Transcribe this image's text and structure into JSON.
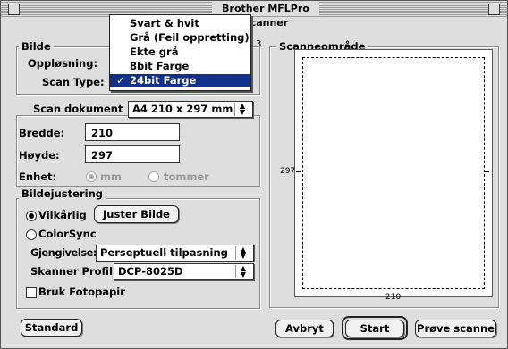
{
  "window": {
    "title": "Brother MFLPro Scanner"
  },
  "image_group": {
    "label": "Bilde",
    "resolution_label": "Oppløsning:",
    "scan_type_label": "Scan Type:",
    "hidden_digit": "3"
  },
  "scan_type_menu": {
    "items": [
      "Svart & hvit",
      "Grå (Feil oppretting)",
      "Ekte grå",
      "8bit Farge",
      "24bit Farge"
    ],
    "selected": "24bit Farge",
    "check_glyph": "✓"
  },
  "document_group": {
    "label": "Scan dokument",
    "size_value": "A4 210 x 297 mm",
    "width_label": "Bredde:",
    "width_value": "210",
    "height_label": "Høyde:",
    "height_value": "297",
    "unit_label": "Enhet:",
    "unit_mm": "mm",
    "unit_inch": "tommer"
  },
  "adjust_group": {
    "label": "Bildejustering",
    "arbitrary_label": "Vilkårlig",
    "adjust_button": "Juster Bilde",
    "colorsync_label": "ColorSync",
    "rendering_label": "Gjengivelse:",
    "rendering_value": "Perseptuell tilpasning",
    "profile_label": "Skanner Profil:",
    "profile_value": "DCP-8025D",
    "photo_paper_label": "Bruk Fotopapir"
  },
  "scan_area": {
    "label": "Scanneområde",
    "height_mark": "297",
    "width_mark": "210"
  },
  "buttons": {
    "standard": "Standard",
    "cancel": "Avbryt",
    "start": "Start",
    "prescan": "Prøve scanne"
  },
  "icons": {
    "popup_arrows": "▲▼"
  }
}
